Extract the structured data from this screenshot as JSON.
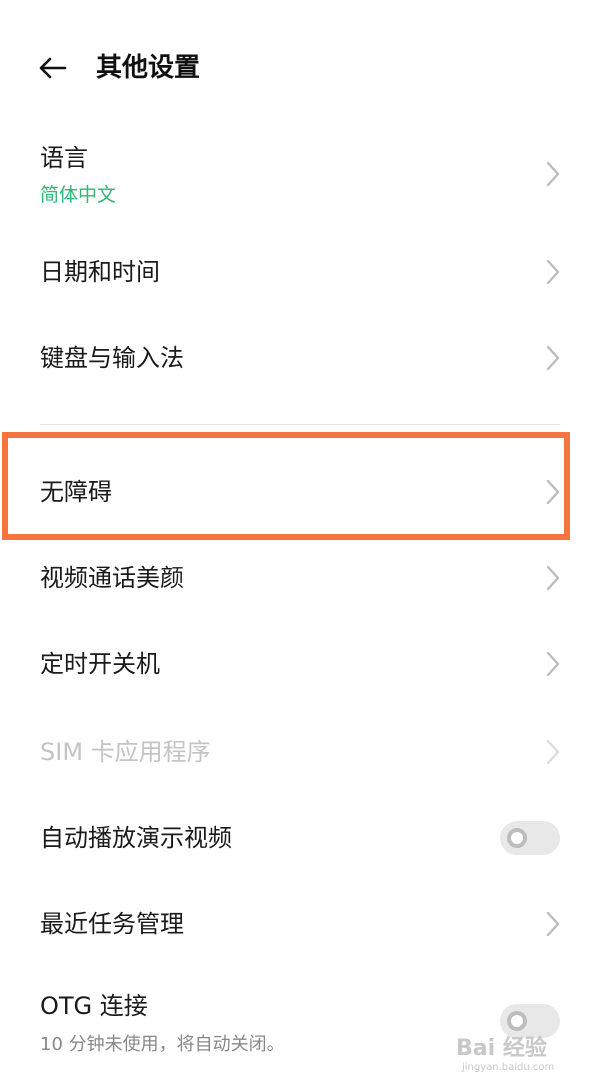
{
  "header": {
    "title": "其他设置"
  },
  "settings": {
    "language": {
      "label": "语言",
      "value": "简体中文",
      "value_color": "#2fb774"
    },
    "date_time": {
      "label": "日期和时间"
    },
    "keyboard": {
      "label": "键盘与输入法"
    },
    "accessibility": {
      "label": "无障碍"
    },
    "video_beauty": {
      "label": "视频通话美颜"
    },
    "scheduled_power": {
      "label": "定时开关机"
    },
    "sim_apps": {
      "label": "SIM 卡应用程序",
      "disabled": true
    },
    "autoplay_demo": {
      "label": "自动播放演示视频",
      "toggle_on": false
    },
    "recent_tasks": {
      "label": "最近任务管理"
    },
    "otg": {
      "label": "OTG 连接",
      "description": "10 分钟未使用，将自动关闭。",
      "toggle_on": false
    }
  },
  "annotation": {
    "highlight_color": "#f5743f"
  },
  "watermark": {
    "text": "Bai 经验",
    "sub": "jingyan.baidu.com"
  }
}
